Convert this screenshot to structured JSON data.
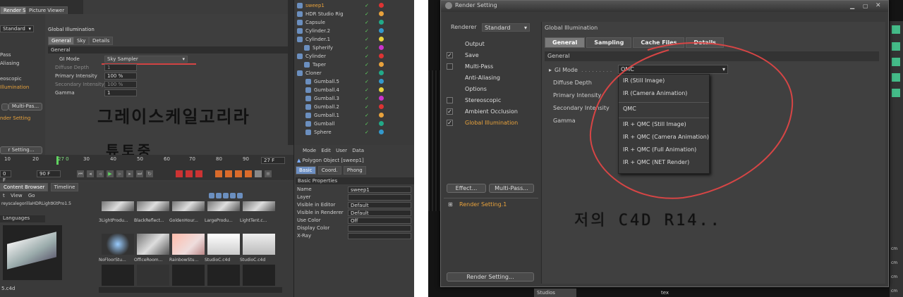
{
  "left": {
    "top_tabs": [
      "Render Settings",
      "Picture Viewer"
    ],
    "renderer_value": "Standard",
    "left_list": [
      "Pass",
      "Aliasing",
      "eoscopic",
      "Illumination"
    ],
    "multipass_btn": "Multi-Pas...",
    "render_setting_item": "nder Setting",
    "render_setting_btn": "r Setting...",
    "gi_title": "Global Illumination",
    "gi_tabs": [
      "General",
      "Sky",
      "Details"
    ],
    "general_section": "General",
    "gi_mode_label": "GI Mode",
    "gi_mode_value": "Sky Sampler",
    "params": [
      {
        "label": "Diffuse Depth",
        "value": "1"
      },
      {
        "label": "Primary Intensity",
        "value": "100 %"
      },
      {
        "label": "Secondary Intensity",
        "value": "100 %"
      },
      {
        "label": "Gamma",
        "value": "1"
      }
    ],
    "handwriting_1": "그레이스케일고리라",
    "handwriting_2": "튜토중",
    "timeline": {
      "ticks": [
        "10",
        "20",
        "27 0",
        "30",
        "40",
        "50",
        "60",
        "70",
        "80",
        "90"
      ],
      "frame_left": "0 F",
      "frame_mid": "90 F",
      "frame_right": "27 F"
    },
    "objects": [
      "sweep1",
      "HDR Studio Rig",
      "Capsule",
      "Cylinder.2",
      "Cylinder.1",
      "Spherify",
      "Cylinder",
      "Taper",
      "Cloner",
      "Gumball.5",
      "Gumball.4",
      "Gumball.3",
      "Gumball.2",
      "Gumball.1",
      "Gumball",
      "Sphere"
    ],
    "attr_menu": [
      "Mode",
      "Edit",
      "User Data"
    ],
    "attr_object": "Polygon Object [sweep1]",
    "attr_tabs": [
      "Basic",
      "Coord.",
      "Phong"
    ],
    "basic_props_title": "Basic Properties",
    "props": [
      {
        "label": "Name",
        "value": "sweep1"
      },
      {
        "label": "Layer",
        "value": ""
      },
      {
        "label": "Visible in Editor",
        "value": "Default"
      },
      {
        "label": "Visible in Renderer",
        "value": "Default"
      },
      {
        "label": "Use Color",
        "value": "Off"
      },
      {
        "label": "Display Color",
        "value": ""
      },
      {
        "label": "X-Ray",
        "value": ""
      }
    ],
    "cb_tabs": [
      "Content Browser",
      "Timeline"
    ],
    "cb_menu": [
      "t",
      "View",
      "Go"
    ],
    "cb_path": "reyscalegorillaHDRLightKitPro1.5",
    "cb_languages": "Languages",
    "cb_bottom_label": "5.c4d",
    "cb_thumbs_row2": [
      "3LightProdu...",
      "BlackReflect...",
      "GoldenHour...",
      "LargeProdu...",
      "LightTent.c..."
    ],
    "cb_thumbs_row3": [
      "NoFloorStu...",
      "OfficeRoom...",
      "RainbowStu...",
      "StudioC.c4d",
      "StudioC.c4d"
    ]
  },
  "right": {
    "window_title": "Render Setting",
    "renderer_label": "Renderer",
    "renderer_value": "Standard",
    "items": [
      {
        "label": "Output",
        "checked": false,
        "has_box": false
      },
      {
        "label": "Save",
        "checked": true,
        "has_box": true
      },
      {
        "label": "Multi-Pass",
        "checked": false,
        "has_box": true
      },
      {
        "label": "Anti-Aliasing",
        "checked": false,
        "has_box": false
      },
      {
        "label": "Options",
        "checked": false,
        "has_box": false
      },
      {
        "label": "Stereoscopic",
        "checked": false,
        "has_box": true
      },
      {
        "label": "Ambient Occlusion",
        "checked": true,
        "has_box": true
      },
      {
        "label": "Global Illumination",
        "checked": true,
        "has_box": true
      }
    ],
    "effect_btn": "Effect...",
    "multipass_btn": "Multi-Pass...",
    "render_setting_item": "Render Setting.1",
    "render_setting_btn": "Render Setting...",
    "gi_title": "Global Illumination",
    "tabs": [
      "General",
      "Sampling",
      "Cache Files",
      "Details"
    ],
    "general_section": "General",
    "gi_mode_label": "GI Mode",
    "gi_mode_value": "QMC",
    "params": [
      "Diffuse Depth",
      "Primary Intensity",
      "Secondary Intensity",
      "Gamma"
    ],
    "dropdown": [
      "IR (Still Image)",
      "IR (Camera Animation)",
      "QMC",
      "IR + QMC (Still Image)",
      "IR + QMC (Camera Animation)",
      "IR + QMC (Full Animation)",
      "IR + QMC (NET Render)"
    ],
    "handwriting": "저의 C4D R14..",
    "bottom_text": "Studios",
    "bottom_text2": "tex",
    "side_labels": [
      "cm",
      "cm",
      "cm",
      "cm"
    ],
    "colors": {
      "accent_orange": "#e8a23c",
      "annotation_red": "#d64545"
    }
  }
}
